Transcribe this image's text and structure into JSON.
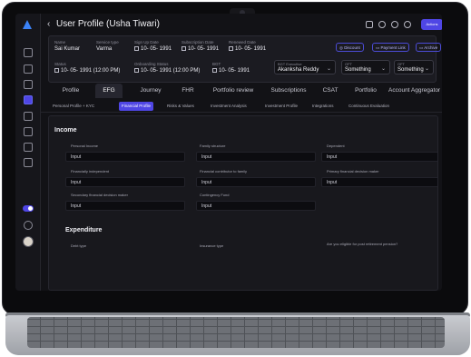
{
  "header": {
    "title": "User Profile (Usha Tiwari)",
    "action_button": "Actions",
    "icons": [
      "mail-icon",
      "chat-icon",
      "refresh-icon",
      "whatsapp-icon"
    ]
  },
  "sidebar": {
    "icons": [
      "link-icon",
      "user-icon",
      "users-icon",
      "chart-icon",
      "trend-icon",
      "document-icon",
      "calendar-icon",
      "settings-icon"
    ],
    "active_index": 3
  },
  "info": {
    "name_label": "Name",
    "name_value": "Sai Kumar",
    "service_type_label": "Service type",
    "service_type_value": "Varma",
    "signup_label": "Sign Up Date",
    "signup_value": "10- 05- 1991",
    "subscription_label": "Subscription Date",
    "subscription_value": "10- 05- 1991",
    "renewed_label": "Renewed Date",
    "renewed_value": "10- 05- 1991",
    "status_label": "Status",
    "status_value": "10- 05- 1991 (12:00 PM)",
    "onboarding_label": "Onboarding Status",
    "onboarding_value": "10- 05- 1991 (12:00 PM)",
    "bgt_label": "BGT",
    "bgt_value": "10- 05- 1991",
    "buttons": {
      "discount": "Discount",
      "payment_link": "Payment Link",
      "archive": "Archive"
    },
    "dropdowns": [
      {
        "label": "BGT Executive",
        "value": "Akanksha Reddy"
      },
      {
        "label": "OFT",
        "value": "Something"
      },
      {
        "label": "OFT",
        "value": "Something"
      }
    ]
  },
  "tabs": [
    "Profile",
    "EFG",
    "Journey",
    "FHR",
    "Portfolio review",
    "Subscriptions",
    "CSAT",
    "Portfolio",
    "Account Aggregator &"
  ],
  "active_tab": "EFG",
  "subtabs": [
    "Personal Profile + KYC",
    "Financial Profile",
    "Risks & Values",
    "Investment Analysis",
    "Investment Profile",
    "Integrations",
    "Continuous Evaluation"
  ],
  "active_subtab": "Financial Profile",
  "income": {
    "title": "Income",
    "fields": [
      {
        "label": "Personal Income",
        "value": "Input"
      },
      {
        "label": "Family structure",
        "value": "Input"
      },
      {
        "label": "Dependent",
        "value": "Input"
      },
      {
        "label": "Financially independent",
        "value": "Input"
      },
      {
        "label": "Financial contributor to family",
        "value": "Input"
      },
      {
        "label": "Primary financial decision maker",
        "value": "Input"
      },
      {
        "label": "Secondary financial decision maker",
        "value": "Input"
      },
      {
        "label": "Contingency Fund",
        "value": "Input"
      }
    ]
  },
  "expenditure": {
    "title": "Expenditure",
    "fields": [
      {
        "label": "Debt type"
      },
      {
        "label": "Insurance type"
      },
      {
        "label": "Are you eligible for post retirement pension?"
      }
    ]
  }
}
